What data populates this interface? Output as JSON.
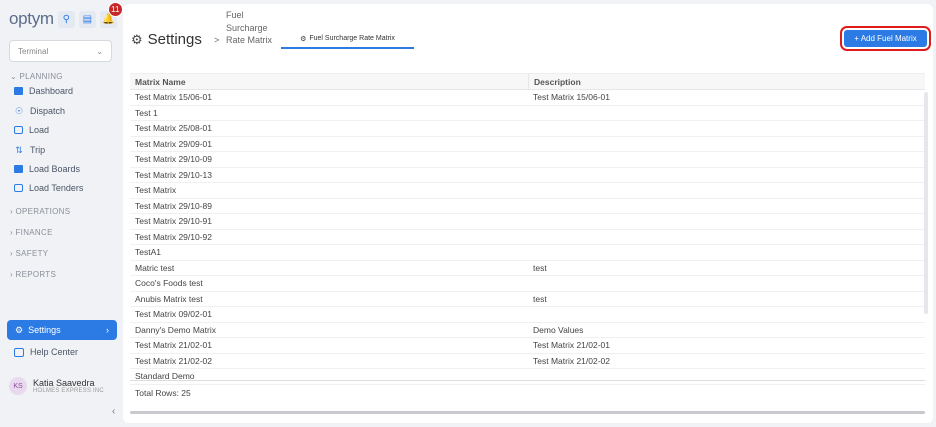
{
  "app": {
    "logo_text": "optym",
    "notification_count": "11",
    "terminal_placeholder": "Terminal"
  },
  "sidebar": {
    "sections": {
      "planning": "PLANNING",
      "operations": "OPERATIONS",
      "finance": "FINANCE",
      "safety": "SAFETY",
      "reports": "REPORTS"
    },
    "planning_items": [
      "Dashboard",
      "Dispatch",
      "Load",
      "Trip",
      "Load Boards",
      "Load Tenders"
    ],
    "settings_label": "Settings",
    "help_label": "Help Center",
    "user": {
      "initials": "KS",
      "name": "Katia Saavedra",
      "company": "HOLMES EXPRESS INC"
    }
  },
  "header": {
    "title": "Settings",
    "breadcrumb": "Fuel Surcharge Rate Matrix",
    "tab_label": "Fuel Surcharge Rate Matrix",
    "add_button": "+ Add Fuel Matrix"
  },
  "table": {
    "columns": [
      "Matrix Name",
      "Description"
    ],
    "rows": [
      [
        "Test Matrix 15/06-01",
        "Test Matrix 15/06-01"
      ],
      [
        "Test 1",
        ""
      ],
      [
        "Test Matrix 25/08-01",
        ""
      ],
      [
        "Test Matrix 29/09-01",
        ""
      ],
      [
        "Test Matrix 29/10-09",
        ""
      ],
      [
        "Test Matrix 29/10-13",
        ""
      ],
      [
        "Test Matrix",
        ""
      ],
      [
        "Test Matrix 29/10-89",
        ""
      ],
      [
        "Test Matrix 29/10-91",
        ""
      ],
      [
        "Test Matrix 29/10-92",
        ""
      ],
      [
        "TestA1",
        ""
      ],
      [
        "Matric test",
        "test"
      ],
      [
        "Coco's Foods test",
        ""
      ],
      [
        "Anubis Matrix test",
        "test"
      ],
      [
        "Test Matrix 09/02-01",
        ""
      ],
      [
        "Danny's Demo Matrix",
        "Demo Values"
      ],
      [
        "Test Matrix 21/02-01",
        "Test Matrix 21/02-01"
      ],
      [
        "Test Matrix 21/02-02",
        "Test Matrix 21/02-02"
      ],
      [
        "Standard Demo",
        ""
      ]
    ],
    "total_rows": "Total Rows: 25"
  },
  "colors": {
    "accent": "#2c7be5",
    "highlight": "#e01b1b",
    "badge": "#c62828"
  }
}
